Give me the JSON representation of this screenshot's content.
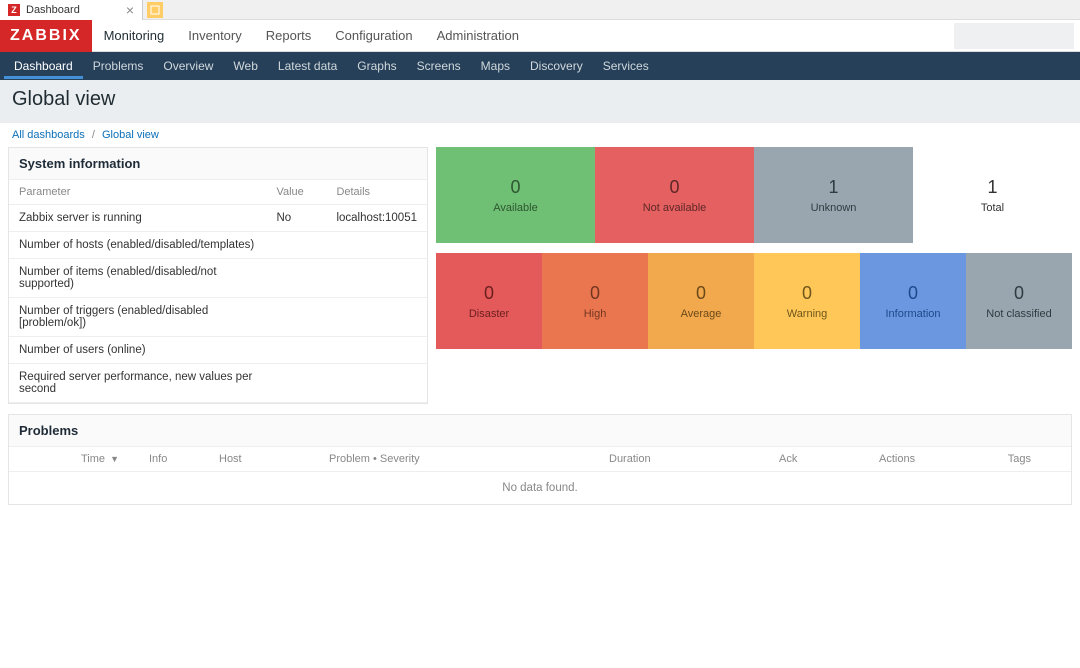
{
  "browser": {
    "tab_title": "Dashboard",
    "favicon_letter": "Z"
  },
  "logo": "ZABBIX",
  "top_nav": {
    "items": [
      "Monitoring",
      "Inventory",
      "Reports",
      "Configuration",
      "Administration"
    ],
    "active_index": 0
  },
  "sub_nav": {
    "items": [
      "Dashboard",
      "Problems",
      "Overview",
      "Web",
      "Latest data",
      "Graphs",
      "Screens",
      "Maps",
      "Discovery",
      "Services"
    ],
    "active_index": 0
  },
  "page_title": "Global view",
  "breadcrumb": {
    "root": "All dashboards",
    "current": "Global view"
  },
  "sysinfo": {
    "title": "System information",
    "headers": {
      "param": "Parameter",
      "value": "Value",
      "details": "Details"
    },
    "rows": [
      {
        "param": "Zabbix server is running",
        "value": "No",
        "details": "localhost:10051",
        "value_red": true
      },
      {
        "param": "Number of hosts (enabled/disabled/templates)",
        "value": "",
        "details": ""
      },
      {
        "param": "Number of items (enabled/disabled/not supported)",
        "value": "",
        "details": ""
      },
      {
        "param": "Number of triggers (enabled/disabled [problem/ok])",
        "value": "",
        "details": ""
      },
      {
        "param": "Number of users (online)",
        "value": "",
        "details": ""
      },
      {
        "param": "Required server performance, new values per second",
        "value": "",
        "details": ""
      }
    ]
  },
  "avail_tiles": [
    {
      "num": "0",
      "label": "Available",
      "cls": "green"
    },
    {
      "num": "0",
      "label": "Not available",
      "cls": "red1"
    },
    {
      "num": "1",
      "label": "Unknown",
      "cls": "gray"
    },
    {
      "num": "1",
      "label": "Total",
      "cls": "white"
    }
  ],
  "sev_tiles": [
    {
      "num": "0",
      "label": "Disaster",
      "cls": "sev-disaster"
    },
    {
      "num": "0",
      "label": "High",
      "cls": "sev-high"
    },
    {
      "num": "0",
      "label": "Average",
      "cls": "sev-average"
    },
    {
      "num": "0",
      "label": "Warning",
      "cls": "sev-warning"
    },
    {
      "num": "0",
      "label": "Information",
      "cls": "sev-info"
    },
    {
      "num": "0",
      "label": "Not classified",
      "cls": "sev-notclass"
    }
  ],
  "problems": {
    "title": "Problems",
    "columns": {
      "time": "Time",
      "info": "Info",
      "host": "Host",
      "prob_sev": "Problem • Severity",
      "duration": "Duration",
      "ack": "Ack",
      "actions": "Actions",
      "tags": "Tags"
    },
    "sort_indicator": "▼",
    "no_data": "No data found."
  }
}
